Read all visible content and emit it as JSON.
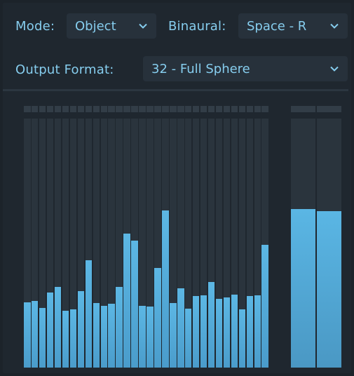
{
  "mode": {
    "label": "Mode:",
    "value": "Object"
  },
  "binaural": {
    "label": "Binaural:",
    "value": "Space - R"
  },
  "output_format": {
    "label": "Output Format:",
    "value": "32 - Full Sphere"
  },
  "icons": {
    "dropdown": "chevron-down-icon"
  },
  "colors": {
    "accent": "#86cdee",
    "meter": "#56b0df",
    "background": "#1c232a"
  },
  "channel_levels": [
    0.263,
    0.267,
    0.24,
    0.302,
    0.324,
    0.229,
    0.234,
    0.306,
    0.43,
    0.259,
    0.249,
    0.257,
    0.324,
    0.538,
    0.511,
    0.248,
    0.246,
    0.4,
    0.63,
    0.259,
    0.317,
    0.237,
    0.287,
    0.289,
    0.343,
    0.276,
    0.282,
    0.293,
    0.233,
    0.287,
    0.29,
    0.493
  ],
  "master_levels": [
    0.636,
    0.628
  ]
}
